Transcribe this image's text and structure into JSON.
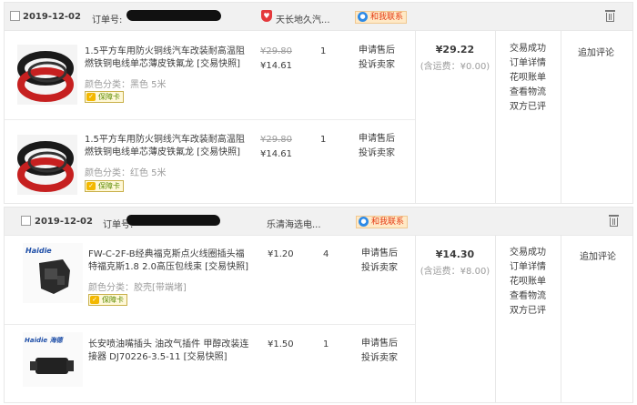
{
  "orders": [
    {
      "date": "2019-12-02",
      "order_no_label": "订单号:",
      "shop": "天长地久汽...",
      "contact": "和我联系",
      "total": "¥29.22",
      "shipping": "(含运费：¥0.00)",
      "status": [
        "交易成功",
        "订单详情",
        "花呗账单",
        "查看物流",
        "双方已评"
      ],
      "review": "追加评论",
      "items": [
        {
          "title": "1.5平方车用防火铜线汽车改装耐高温阻燃铁铜电线单芯薄皮铁氟龙 [交易快照]",
          "sku": "颜色分类：黑色 5米",
          "badge": "保障卡",
          "price_orig": "¥29.80",
          "price_now": "¥14.61",
          "qty": "1",
          "service": [
            "申请售后",
            "投诉卖家"
          ]
        },
        {
          "title": "1.5平方车用防火铜线汽车改装耐高温阻燃铁铜电线单芯薄皮铁氟龙 [交易快照]",
          "sku": "颜色分类：红色 5米",
          "badge": "保障卡",
          "price_orig": "¥29.80",
          "price_now": "¥14.61",
          "qty": "1",
          "service": [
            "申请售后",
            "投诉卖家"
          ]
        }
      ]
    },
    {
      "date": "2019-12-02",
      "order_no_label": "订单号:",
      "shop": "乐清海选电...",
      "contact": "和我联系",
      "total": "¥14.30",
      "shipping": "(含运费：¥8.00)",
      "status": [
        "交易成功",
        "订单详情",
        "花呗账单",
        "查看物流",
        "双方已评"
      ],
      "review": "追加评论",
      "items": [
        {
          "brand": "Haidie",
          "title": "FW-C-2F-B经典福克斯点火线圈插头福特福克斯1.8 2.0高压包线束 [交易快照]",
          "sku": "颜色分类：胶壳[带端堵]",
          "badge": "保障卡",
          "price_now": "¥1.20",
          "qty": "4",
          "service": [
            "申请售后",
            "投诉卖家"
          ]
        },
        {
          "brand": "Haidie 海德",
          "title": "长安喷油嘴插头 油改气插件 甲醇改装连接器 DJ70226-3.5-11 [交易快照]",
          "price_now": "¥1.50",
          "qty": "1",
          "service": [
            "申请售后",
            "投诉卖家"
          ]
        }
      ]
    }
  ]
}
